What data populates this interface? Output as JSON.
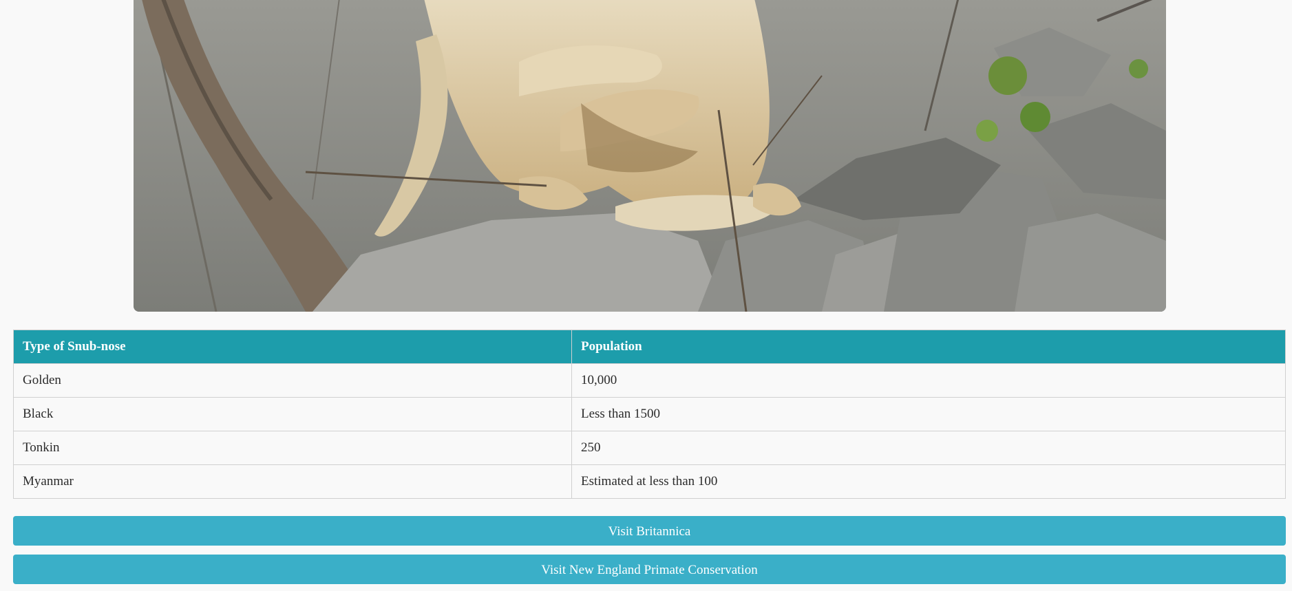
{
  "photo": {
    "subject": "golden-snub-nosed-monkey-on-rocks"
  },
  "table": {
    "headers": [
      "Type of Snub-nose",
      "Population"
    ],
    "rows": [
      [
        "Golden",
        "10,000"
      ],
      [
        "Black",
        "Less than 1500"
      ],
      [
        "Tonkin",
        "250"
      ],
      [
        "Myanmar",
        "Estimated at less than 100"
      ]
    ]
  },
  "buttons": {
    "britannica": "Visit Britannica",
    "primate": "Visit New England Primate Conservation"
  },
  "colors": {
    "table_header": "#1d9dab",
    "button": "#3aafc8",
    "background": "#f9f9f9"
  }
}
